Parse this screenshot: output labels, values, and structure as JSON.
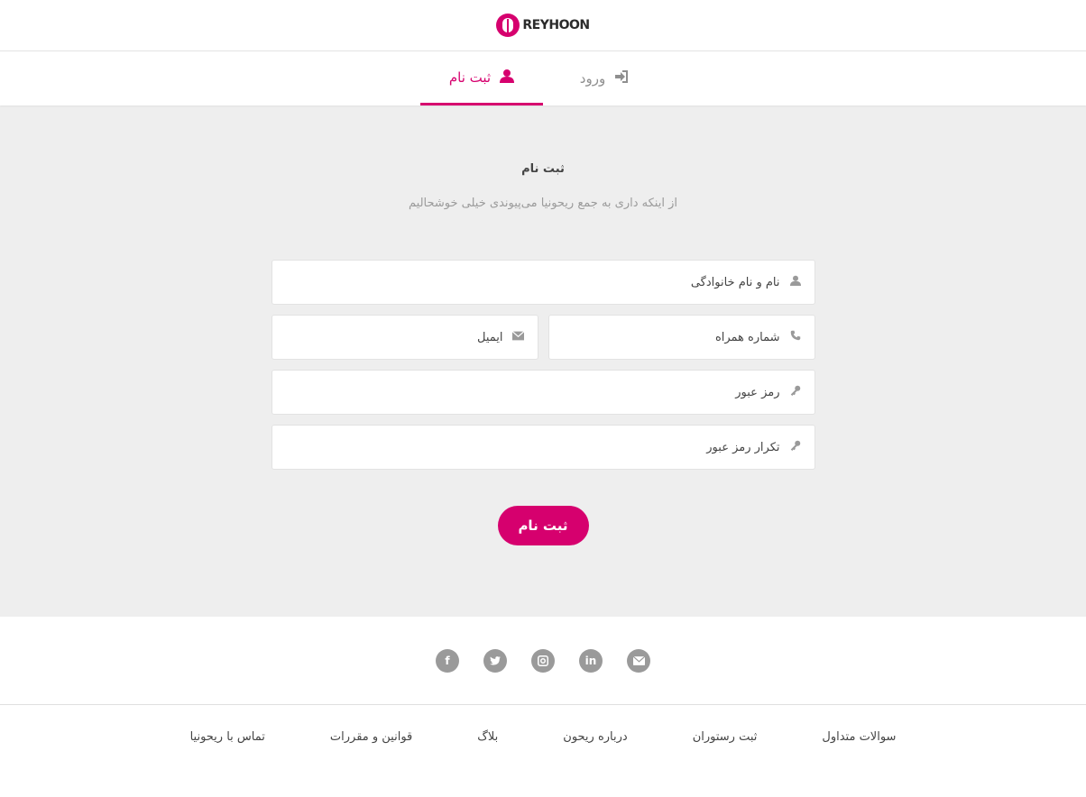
{
  "header": {
    "logo_text": "REYHOON"
  },
  "tabs": [
    {
      "label": "ورود",
      "icon": "login-icon",
      "active": false
    },
    {
      "label": "ثبت نام",
      "icon": "user-icon",
      "active": true
    }
  ],
  "main": {
    "title": "ثبت نام",
    "subtitle": "از اینکه داری به جمع ریحونیا می‌پیوندی خیلی خوشحالیم",
    "fields": {
      "fullname": {
        "placeholder": "نام و نام خانوادگی",
        "icon": "user-icon",
        "value": ""
      },
      "phone": {
        "placeholder": "شماره همراه",
        "icon": "phone-icon",
        "value": ""
      },
      "email": {
        "placeholder": "ایمیل",
        "icon": "envelope-icon",
        "value": ""
      },
      "password": {
        "placeholder": "رمز عبور",
        "icon": "key-icon",
        "value": ""
      },
      "password_repeat": {
        "placeholder": "تکرار رمز عبور",
        "icon": "key-icon",
        "value": ""
      }
    },
    "submit_label": "ثبت نام"
  },
  "footer": {
    "social": [
      "email-icon",
      "linkedin-icon",
      "instagram-icon",
      "twitter-icon",
      "facebook-icon"
    ],
    "links": [
      "سوالات متداول",
      "ثبت رستوران",
      "درباره ریحون",
      "بلاگ",
      "قوانین و مقررات",
      "تماس با ریحونیا"
    ]
  },
  "colors": {
    "accent": "#d6006e",
    "background": "#eeeeee",
    "icon_gray": "#9a9a9a"
  }
}
